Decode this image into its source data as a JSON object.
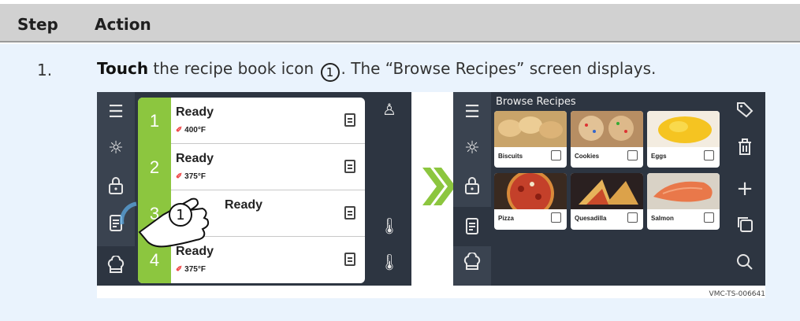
{
  "table": {
    "header_step": "Step",
    "header_action": "Action"
  },
  "step": {
    "number": "1.",
    "bold_word": "Touch",
    "text_before_marker": " the recipe book icon ",
    "marker": "1",
    "text_after_marker": ". The “Browse Recipes” screen displays."
  },
  "figure": {
    "left_screen": {
      "rail_icons": [
        "menu-icon",
        "brightness-icon",
        "lock-icon",
        "recipe-book-icon",
        "chef-hat-icon"
      ],
      "active_rail_icon": "chef-hat-icon",
      "slots": [
        {
          "number": "1",
          "status": "Ready",
          "temp": "400°F"
        },
        {
          "number": "2",
          "status": "Ready",
          "temp": "375°F"
        },
        {
          "number": "3",
          "status": "Ready",
          "temp": ""
        },
        {
          "number": "4",
          "status": "Ready",
          "temp": "375°F"
        }
      ],
      "hand_marker": "1",
      "right_icons": [
        "user-icon",
        "probe-icon",
        "probe-icon"
      ]
    },
    "right_screen": {
      "title": "Browse Recipes",
      "rail_icons": [
        "menu-icon",
        "brightness-icon",
        "lock-icon",
        "recipe-book-icon",
        "chef-hat-icon"
      ],
      "active_rail_icon": "recipe-book-icon",
      "recipes": [
        "Biscuits",
        "Cookies",
        "Eggs",
        "Pizza",
        "Quesadilla",
        "Salmon"
      ],
      "right_icons": [
        "tag-icon",
        "trash-icon",
        "add-icon",
        "copy-icon",
        "search-icon"
      ]
    },
    "code": "VMC-TS-006641",
    "colors": {
      "accent_green": "#8cc63f",
      "screen_bg": "#2d3541"
    }
  }
}
